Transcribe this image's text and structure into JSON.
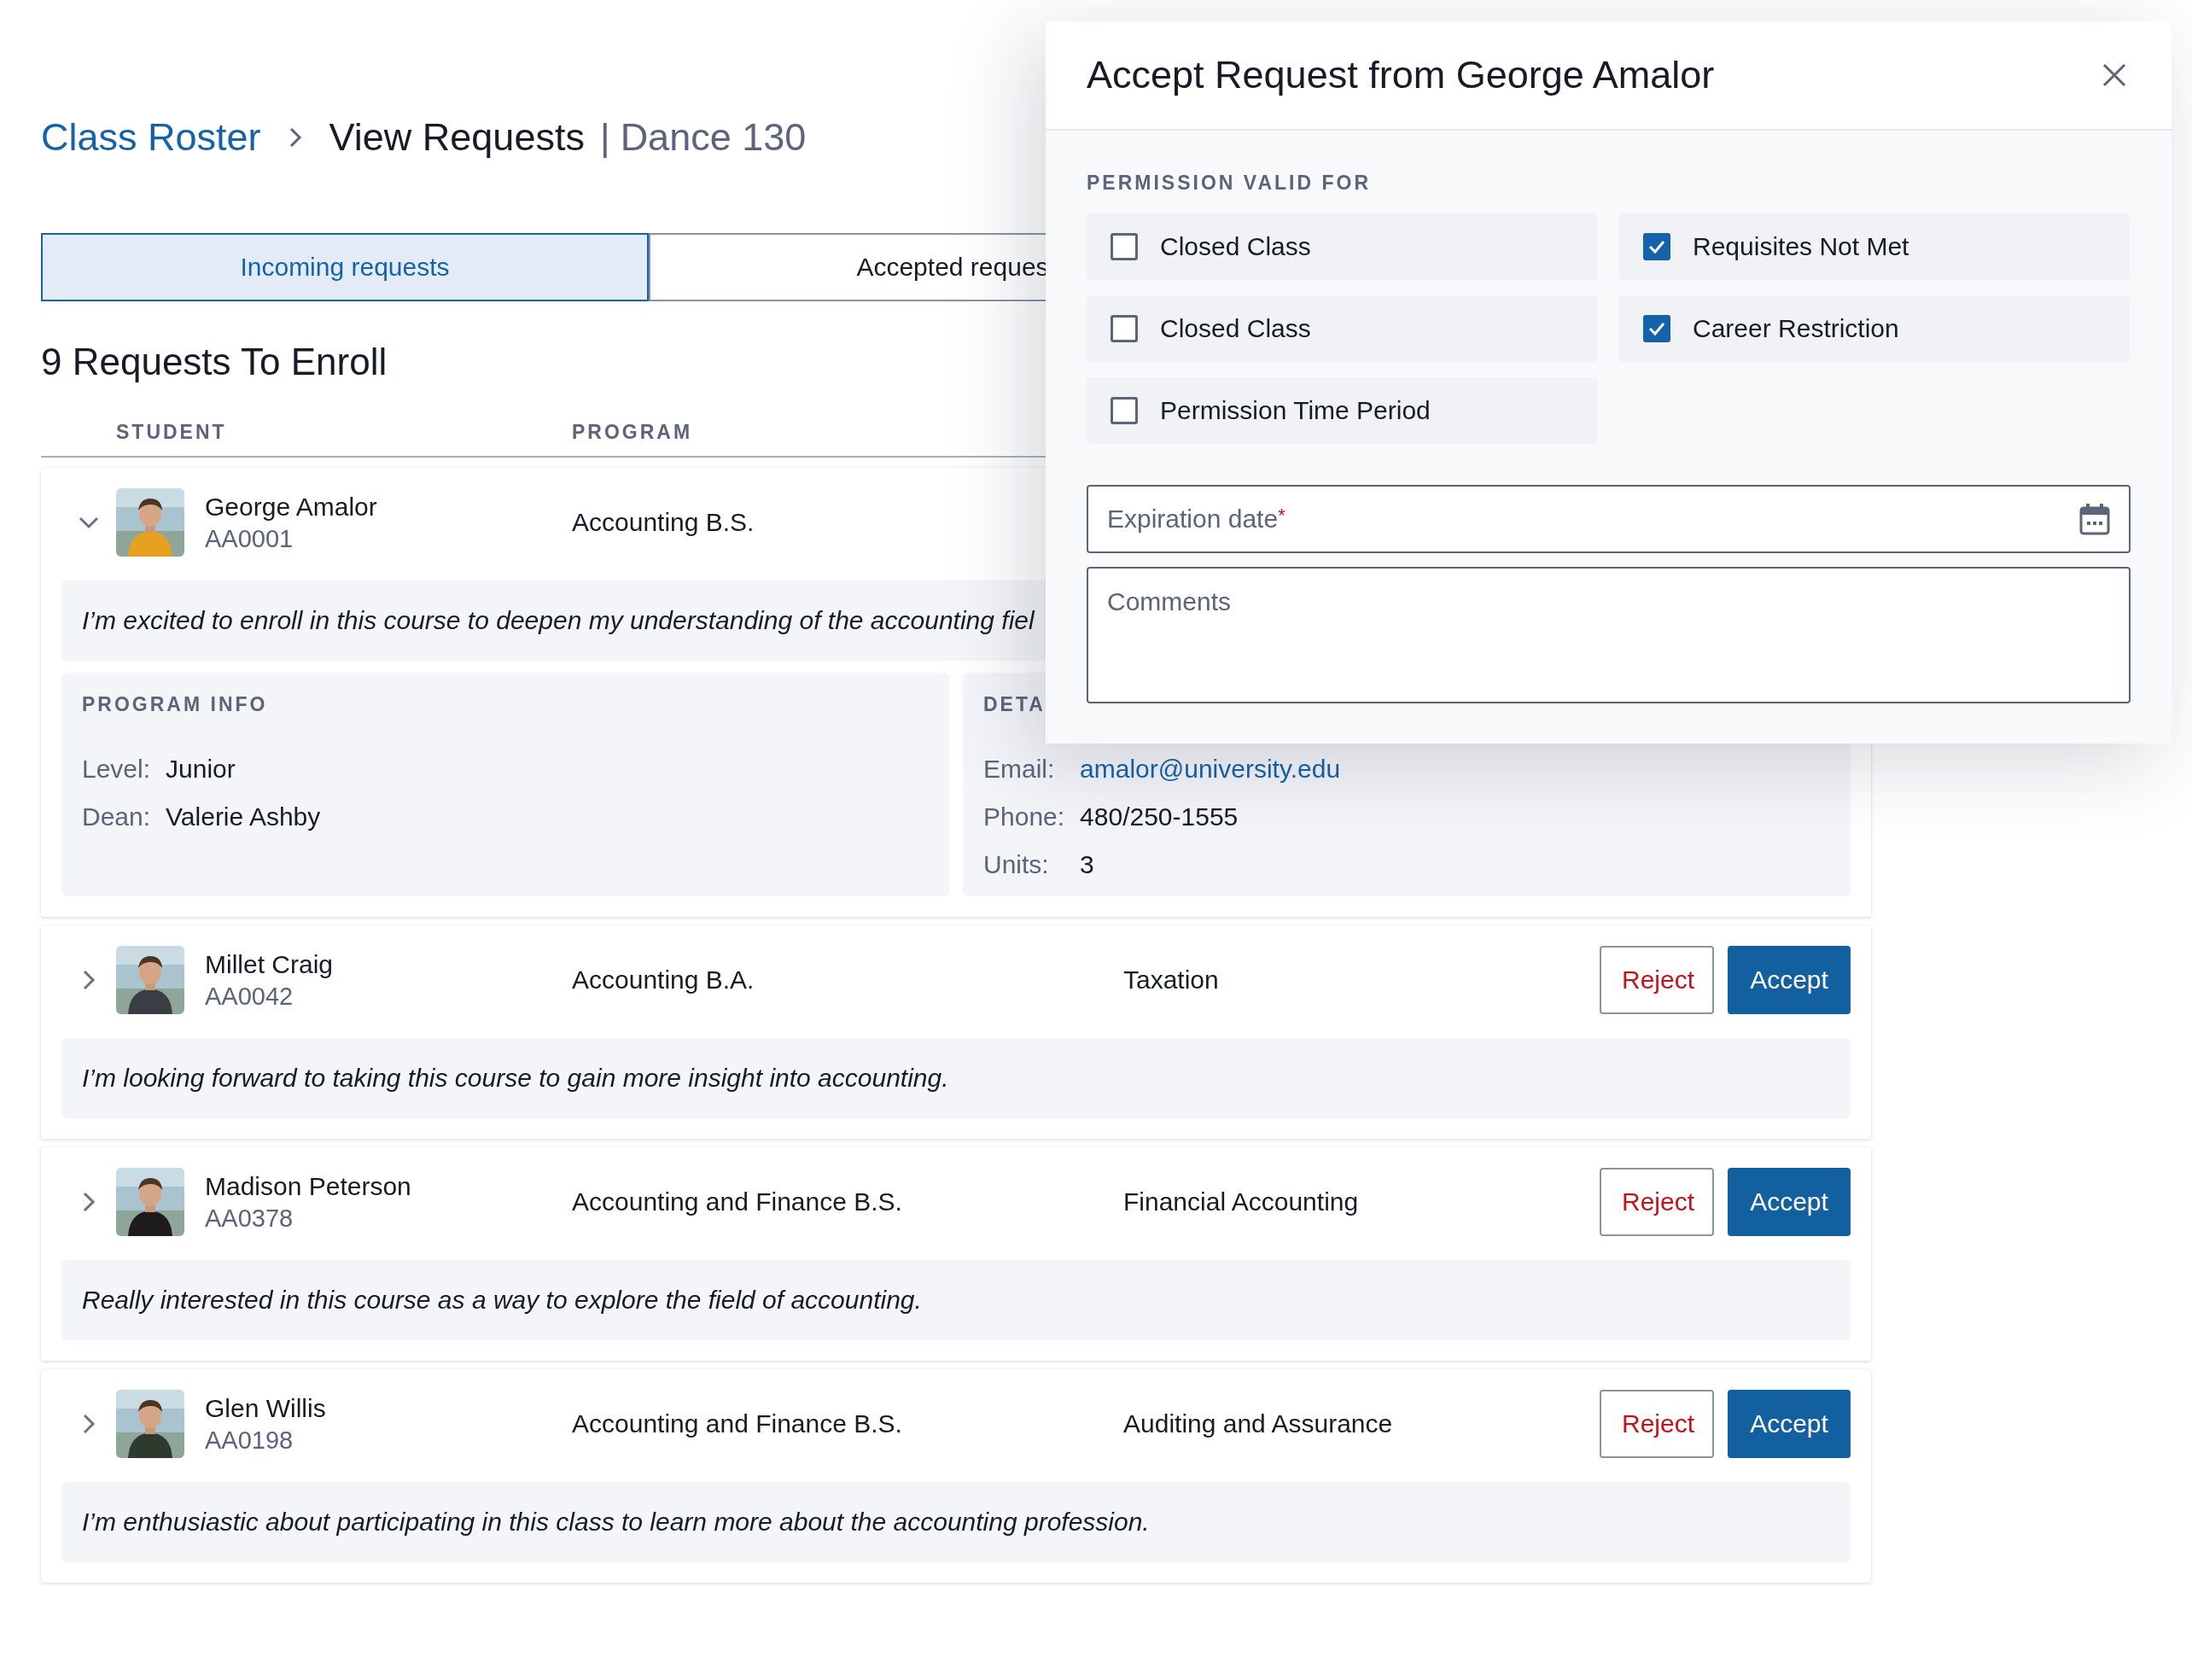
{
  "breadcrumb": {
    "parent": "Class Roster",
    "current": "View Requests",
    "divider": "|",
    "course": "Dance 130"
  },
  "tabs": [
    {
      "label": "Incoming requests",
      "selected": true
    },
    {
      "label": "Accepted reques",
      "selected": false
    }
  ],
  "heading": "9 Requests To Enroll",
  "table": {
    "columns": [
      "STUDENT",
      "PROGRAM"
    ],
    "rows": [
      {
        "name": "George Amalor",
        "id": "AA0001",
        "program": "Accounting B.S.",
        "expanded": true,
        "comment": "I’m excited to enroll in this course to deepen my understanding of the accounting fiel",
        "panels": [
          {
            "title": "PROGRAM INFO",
            "fields": [
              {
                "label": "Level:",
                "value": "Junior",
                "kind": "text"
              },
              {
                "label": "Dean:",
                "value": "Valerie Ashby",
                "kind": "text"
              }
            ]
          },
          {
            "title": "DETA",
            "fields": [
              {
                "label": "Email:",
                "value": "amalor@university.edu",
                "kind": "link"
              },
              {
                "label": "Phone:",
                "value": "480/250-1555",
                "kind": "text"
              },
              {
                "label": "Units:",
                "value": "3",
                "kind": "text"
              }
            ]
          }
        ]
      },
      {
        "name": "Millet Craig",
        "id": "AA0042",
        "program": "Accounting B.A.",
        "course": "Taxation",
        "expanded": false,
        "comment": "I’m looking forward to taking this course to gain more insight into accounting.",
        "actions": [
          "Reject",
          "Accept"
        ]
      },
      {
        "name": "Madison Peterson",
        "id": "AA0378",
        "program": "Accounting and Finance B.S.",
        "course": "Financial Accounting",
        "expanded": false,
        "comment": "Really interested in this course as a way to explore the field of accounting.",
        "actions": [
          "Reject",
          "Accept"
        ]
      },
      {
        "name": "Glen Willis",
        "id": "AA0198",
        "program": "Accounting and Finance B.S.",
        "course": "Auditing and Assurance",
        "expanded": false,
        "comment": "I’m enthusiastic about participating in this class to learn more about the accounting profession.",
        "actions": [
          "Reject",
          "Accept"
        ]
      }
    ]
  },
  "modal": {
    "title": "Accept Request from George Amalor",
    "section_label": "PERMISSION VALID FOR",
    "options": [
      {
        "label": "Closed Class",
        "checked": false
      },
      {
        "label": "Requisites Not Met",
        "checked": true
      },
      {
        "label": "Closed Class",
        "checked": false
      },
      {
        "label": "Career Restriction",
        "checked": true
      },
      {
        "label": "Permission Time Period",
        "checked": false
      }
    ],
    "expiration": {
      "placeholder": "Expiration date",
      "required_mark": "*"
    },
    "comments": {
      "placeholder": "Comments"
    }
  }
}
